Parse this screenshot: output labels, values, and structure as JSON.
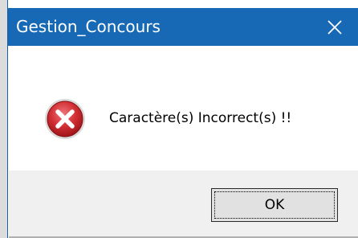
{
  "window": {
    "title": "Gestion_Concours",
    "titlebar_color": "#1769b6",
    "close_icon": "close-icon"
  },
  "dialog": {
    "icon": "error-icon",
    "icon_color": "#c9252c",
    "message": "Caractère(s) Incorrect(s) !!"
  },
  "buttons": {
    "ok_label": "OK"
  }
}
